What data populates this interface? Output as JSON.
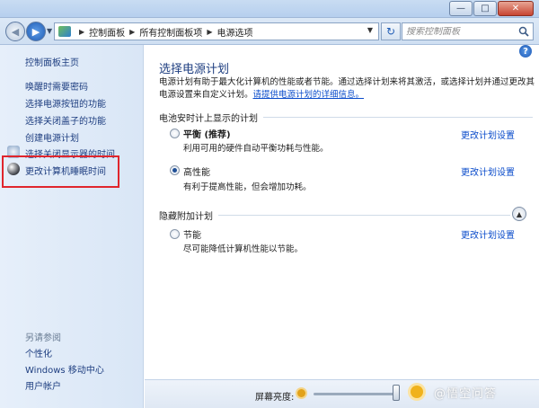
{
  "window": {
    "minimize_glyph": "—",
    "maximize_glyph": "□",
    "close_glyph": "✕"
  },
  "address": {
    "breadcrumbs": [
      "控制面板",
      "所有控制面板项",
      "电源选项"
    ],
    "search_placeholder": "搜索控制面板"
  },
  "sidebar": {
    "home": "控制面板主页",
    "links": [
      "唤醒时需要密码",
      "选择电源按钮的功能",
      "选择关闭盖子的功能",
      "创建电源计划",
      "选择关闭显示器的时间",
      "更改计算机睡眠时间"
    ],
    "see_also_label": "另请参阅",
    "see_also": [
      "个性化",
      "Windows 移动中心",
      "用户帐户"
    ]
  },
  "main": {
    "title": "选择电源计划",
    "intro_text": "电源计划有助于最大化计算机的性能或者节能。通过选择计划来将其激活，或选择计划并通过更改其电源设置来自定义计划。",
    "intro_link": "请提供电源计划的详细信息。",
    "group_battery": "电池安时计上显示的计划",
    "group_hidden": "隐藏附加计划",
    "plans": [
      {
        "name": "平衡 (推荐)",
        "desc": "利用可用的硬件自动平衡功耗与性能。",
        "link": "更改计划设置",
        "checked": false
      },
      {
        "name": "高性能",
        "desc": "有利于提高性能，但会增加功耗。",
        "link": "更改计划设置",
        "checked": true
      },
      {
        "name": "节能",
        "desc": "尽可能降低计算机性能以节能。",
        "link": "更改计划设置",
        "checked": false
      }
    ]
  },
  "bottom": {
    "brightness_label": "屏幕亮度:",
    "brightness_level": 1.0,
    "watermark": "@悟空问答"
  }
}
